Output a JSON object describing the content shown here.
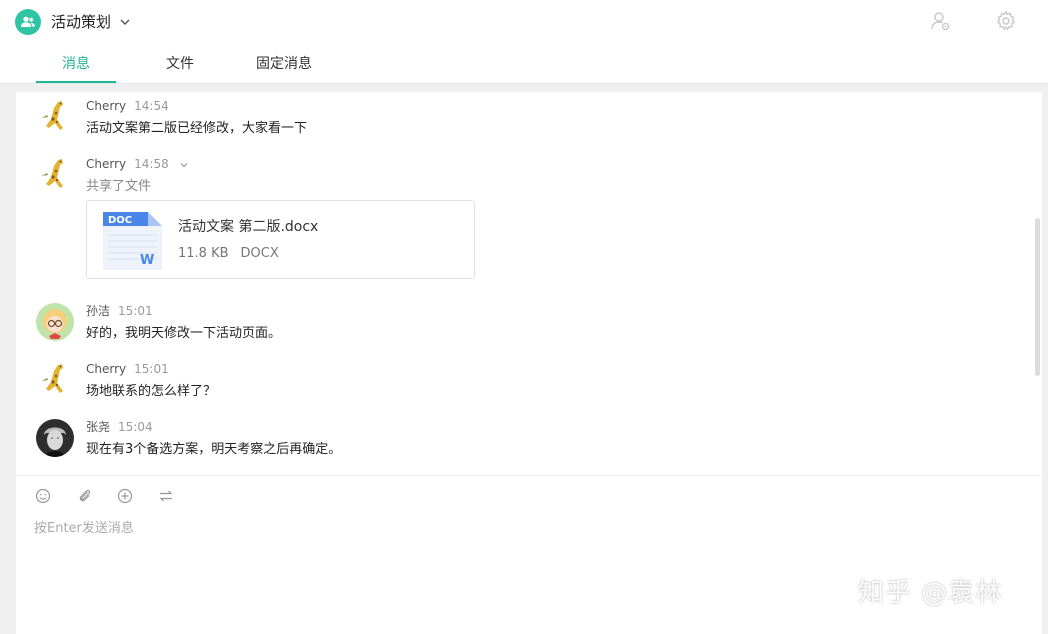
{
  "header": {
    "group_title": "活动策划",
    "tabs": [
      {
        "label": "消息",
        "active": true
      },
      {
        "label": "文件",
        "active": false
      },
      {
        "label": "固定消息",
        "active": false
      }
    ]
  },
  "messages": [
    {
      "sender": "Cherry",
      "time": "14:54",
      "text": "活动文案第二版已经修改，大家看一下",
      "avatar": "giraffe"
    },
    {
      "sender": "Cherry",
      "time": "14:58",
      "text": "共享了文件",
      "avatar": "giraffe",
      "file": {
        "badge": "DOC",
        "letter": "W",
        "name": "活动文案 第二版.docx",
        "size": "11.8 KB",
        "type": "DOCX"
      }
    },
    {
      "sender": "孙洁",
      "time": "15:01",
      "text": "好的，我明天修改一下活动页面。",
      "avatar": "girl"
    },
    {
      "sender": "Cherry",
      "time": "15:01",
      "text": "场地联系的怎么样了？",
      "avatar": "giraffe"
    },
    {
      "sender": "张尧",
      "time": "15:04",
      "text": "现在有3个备选方案，明天考察之后再确定。",
      "avatar": "man"
    }
  ],
  "composer": {
    "placeholder": "按Enter发送消息"
  },
  "watermark": "知乎 @袁林",
  "colors": {
    "accent": "#21b693",
    "group_avatar": "#2fc5a4"
  }
}
